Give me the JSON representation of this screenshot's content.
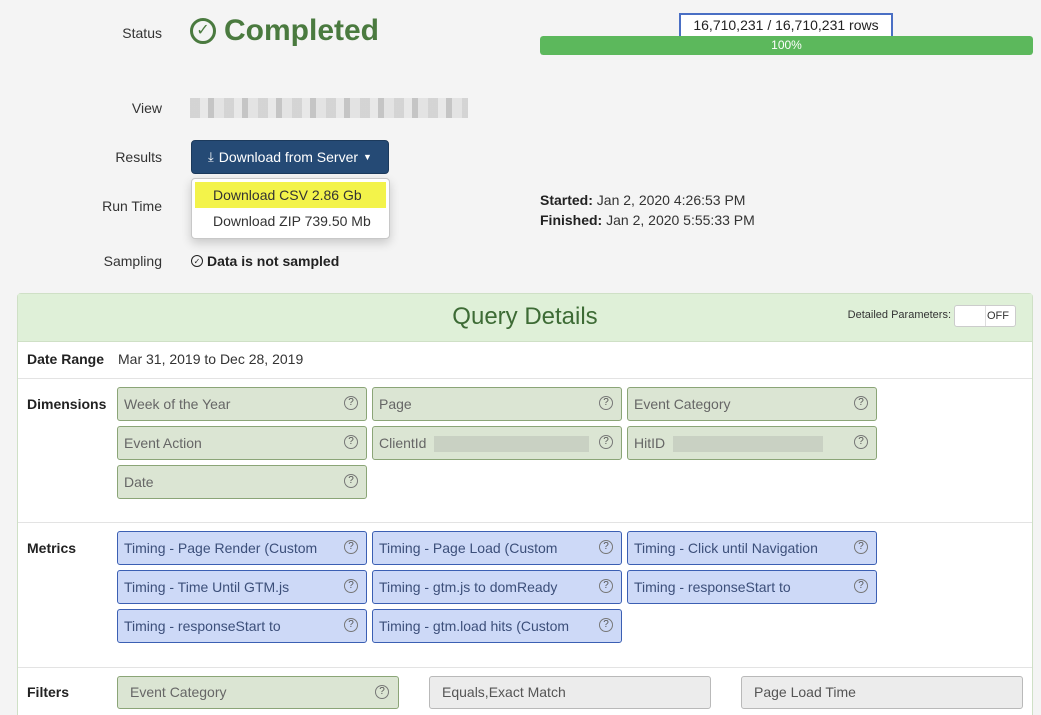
{
  "status": {
    "label": "Status",
    "value": "Completed",
    "icon": "check-circle-icon",
    "color": "#4a7a3f"
  },
  "progress": {
    "rows_text": "16,710,231 / 16,710,231 rows",
    "percent_text": "100%",
    "fraction": 1.0,
    "bar_color": "#5cb85c"
  },
  "view": {
    "label": "View"
  },
  "results": {
    "label": "Results",
    "button_label": "Download from Server",
    "button_color": "#254a75",
    "menu": [
      {
        "label": "Download CSV 2.86 Gb",
        "highlighted": true
      },
      {
        "label": "Download ZIP 739.50 Mb",
        "highlighted": false
      }
    ]
  },
  "runtime": {
    "label": "Run Time",
    "started_label": "Started:",
    "started_value": "Jan 2, 2020 4:26:53 PM",
    "finished_label": "Finished:",
    "finished_value": "Jan 2, 2020 5:55:33 PM"
  },
  "sampling": {
    "label": "Sampling",
    "value": "Data is not sampled"
  },
  "query_details": {
    "title": "Query Details",
    "detailed_params_label": "Detailed Parameters:",
    "toggle_state": "OFF",
    "date_range": {
      "label": "Date Range",
      "value": "Mar 31, 2019 to Dec 28, 2019"
    },
    "dimensions": {
      "label": "Dimensions",
      "items": [
        "Week of the Year",
        "Page",
        "Event Category",
        "Event Action",
        "ClientId",
        "HitID",
        "Date"
      ]
    },
    "metrics": {
      "label": "Metrics",
      "items": [
        "Timing - Page Render (Custom",
        "Timing - Page Load (Custom",
        "Timing - Click until Navigation",
        "Timing - Time Until GTM.js",
        "Timing - gtm.js to domReady",
        "Timing - responseStart to",
        "Timing - responseStart to",
        "Timing - gtm.load hits (Custom"
      ]
    },
    "filters": {
      "label": "Filters",
      "dimension": "Event Category",
      "operator": "Equals,Exact Match",
      "value": "Page Load Time"
    }
  },
  "colors": {
    "dimension_chip_bg": "#dbe5d3",
    "metric_chip_bg": "#cdd9f7",
    "panel_header_bg": "#dff0d8",
    "highlight": "#f3f34a"
  }
}
